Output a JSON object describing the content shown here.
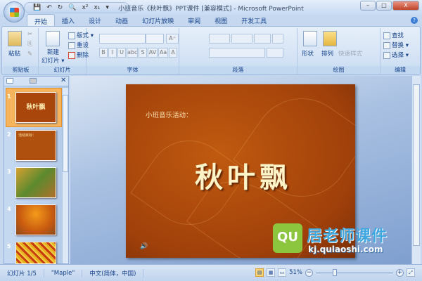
{
  "window": {
    "title": "小班音乐《秋叶飘》PPT课件 [兼容模式] - Microsoft PowerPoint",
    "minimize": "–",
    "maximize": "□",
    "close": "X"
  },
  "qat": {
    "save": "💾",
    "undo": "↶",
    "redo": "↻",
    "preview": "🔍",
    "superscript": "x²",
    "subscript": "x₁",
    "more": "▾"
  },
  "tabs": [
    "开始",
    "插入",
    "设计",
    "动画",
    "幻灯片放映",
    "审阅",
    "视图",
    "开发工具"
  ],
  "help": "?",
  "ribbon": {
    "clipboard": {
      "label": "剪贴板",
      "paste": "粘贴",
      "cut": "✂",
      "copy": "⎘",
      "painter": "✎"
    },
    "slides": {
      "label": "幻灯片",
      "new_slide": "新建",
      "new_slide2": "幻灯片 ▾",
      "layout": "版式 ▾",
      "reset": "重设",
      "delete": "删除"
    },
    "font": {
      "label": "字体",
      "bold": "B",
      "italic": "I",
      "underline": "U",
      "strike": "abc",
      "shadow": "S",
      "spacing": "AV",
      "case": "Aa",
      "color": "A",
      "grow": "A⁺",
      "shrink": "A⁻",
      "clear": "A✎"
    },
    "paragraph": {
      "label": "段落"
    },
    "drawing": {
      "label": "绘图",
      "shapes": "形状",
      "arrange": "排列",
      "quick_styles": "快速样式"
    },
    "editing": {
      "label": "编辑",
      "find": "查找",
      "replace": "替换 ▾",
      "select": "选择 ▾"
    }
  },
  "slide_panel": {
    "slides": [
      "1",
      "2",
      "3",
      "4",
      "5"
    ],
    "selected": 1,
    "thumb1_title": "秋叶飘",
    "thumb2_title": "活动目标："
  },
  "slide": {
    "subtitle": "小班音乐活动：",
    "title": "秋叶飘",
    "sound_icon": "🔊"
  },
  "watermark": {
    "logo": "QU",
    "name": "居老师课件",
    "url": "kj.qulaoshi.com"
  },
  "status": {
    "slide": "幻灯片 1/5",
    "theme": "\"Maple\"",
    "language": "中文(简体，中国)",
    "zoom": "51%",
    "zoom_level": 51
  },
  "colors": {
    "slide_bg": "#a0400a",
    "title": "#fff3c8",
    "ribbon": "#d6e4f5",
    "accent": "#f6b45c"
  }
}
